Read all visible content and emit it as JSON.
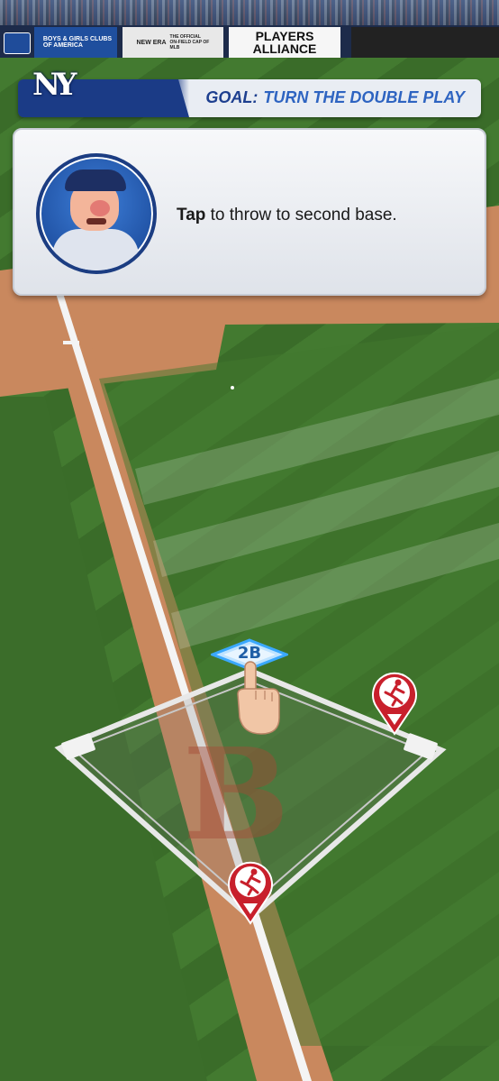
{
  "ads": {
    "boys_girls_clubs": "BOYS & GIRLS CLUBS",
    "boys_girls_clubs_sub": "OF AMERICA",
    "new_era": "NEW ERA",
    "new_era_sub": "THE OFFICIAL ON-FIELD CAP OF MLB",
    "players_line1": "PLAYERS",
    "players_line2": "ALLIANCE"
  },
  "header": {
    "team_logo": "NY",
    "goal_label": "GOAL:",
    "goal_text": "TURN THE DOUBLE PLAY"
  },
  "dialog": {
    "instruction_bold": "Tap",
    "instruction_rest": " to throw to second base."
  },
  "bases": {
    "second_base_label": "2B"
  },
  "icons": {
    "runner": "runner-marker-icon",
    "hand": "tap-hand-icon",
    "team": "boston-b-logo"
  },
  "colors": {
    "grass_light": "#437a30",
    "grass_dark": "#3a6c29",
    "dirt": "#c9885e",
    "accent_blue": "#1b3b86",
    "runner_red": "#c8202c"
  }
}
